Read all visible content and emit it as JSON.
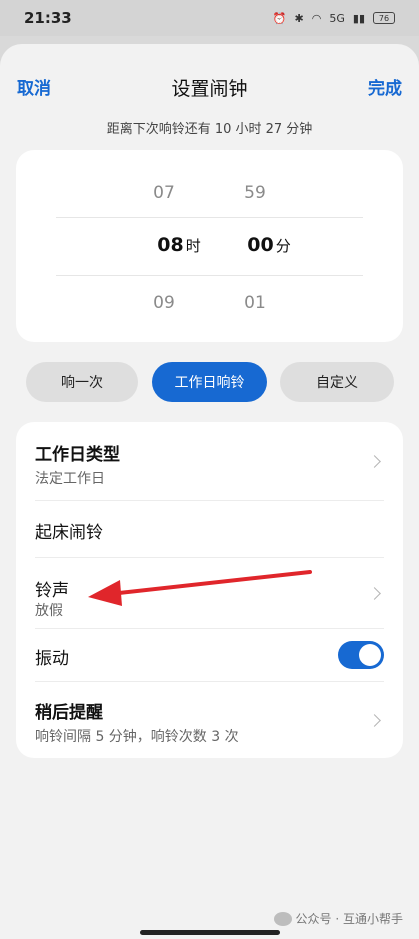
{
  "status": {
    "time": "21:33",
    "battery": "76",
    "network": "5G"
  },
  "header": {
    "cancel": "取消",
    "title": "设置闹钟",
    "done": "完成"
  },
  "countdown": "距离下次响铃还有 10 小时 27 分钟",
  "picker": {
    "hours": {
      "prev": "07",
      "selected": "08",
      "next": "09",
      "unit": "时"
    },
    "minutes": {
      "prev": "59",
      "selected": "00",
      "next": "01",
      "unit": "分"
    }
  },
  "modes": [
    {
      "label": "响一次",
      "active": false
    },
    {
      "label": "工作日响铃",
      "active": true
    },
    {
      "label": "自定义",
      "active": false
    }
  ],
  "settings": {
    "workday_type": {
      "title": "工作日类型",
      "value": "法定工作日"
    },
    "wakeup": {
      "title": "起床闹铃"
    },
    "ringtone": {
      "title": "铃声",
      "value": "放假"
    },
    "vibration": {
      "title": "振动",
      "enabled": true
    },
    "snooze": {
      "title": "稍后提醒",
      "value": "响铃间隔 5 分钟，响铃次数 3 次"
    }
  },
  "watermark": "公众号 · 互通小帮手",
  "colors": {
    "accent": "#1769d2",
    "annotation": "#e0262b"
  }
}
